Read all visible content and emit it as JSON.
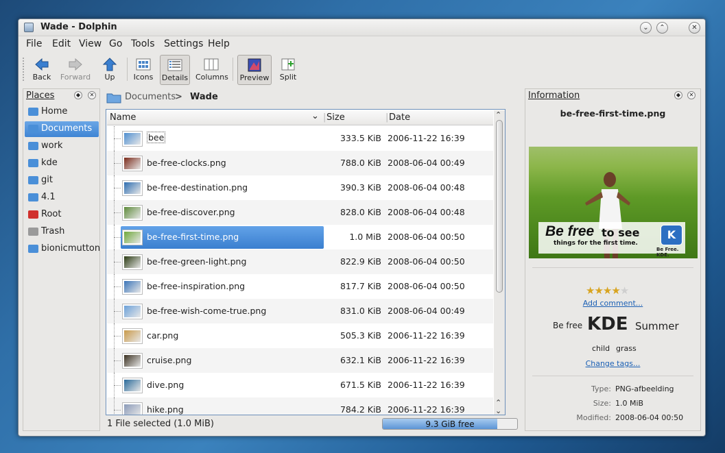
{
  "window": {
    "title": "Wade - Dolphin"
  },
  "menu": [
    "File",
    "Edit",
    "View",
    "Go",
    "Tools",
    "Settings",
    "Help"
  ],
  "toolbar": {
    "back": "Back",
    "forward": "Forward",
    "up": "Up",
    "icons": "Icons",
    "details": "Details",
    "columns": "Columns",
    "preview": "Preview",
    "split": "Split"
  },
  "places": {
    "title": "Places",
    "items": [
      {
        "label": "Home",
        "color": "#4a8fd8"
      },
      {
        "label": "Documents",
        "color": "#4a8fd8"
      },
      {
        "label": "work",
        "color": "#4a8fd8"
      },
      {
        "label": "kde",
        "color": "#4a8fd8"
      },
      {
        "label": "git",
        "color": "#4a8fd8"
      },
      {
        "label": "4.1",
        "color": "#4a8fd8"
      },
      {
        "label": "Root",
        "color": "#d0312d"
      },
      {
        "label": "Trash",
        "color": "#9a9a9a"
      },
      {
        "label": "bionicmutton",
        "color": "#4a8fd8"
      }
    ]
  },
  "breadcrumb": {
    "parent": "Documents",
    "separator": ">",
    "current": "Wade"
  },
  "columns": {
    "name": "Name",
    "size": "Size",
    "date": "Date"
  },
  "files": [
    {
      "name": "bee",
      "size": "333.5 KiB",
      "date": "2006-11-22 16:39",
      "thumb": "#4f8fd0"
    },
    {
      "name": "be-free-clocks.png",
      "size": "788.0 KiB",
      "date": "2008-06-04 00:49",
      "thumb": "#7a2a1a"
    },
    {
      "name": "be-free-destination.png",
      "size": "390.3 KiB",
      "date": "2008-06-04 00:48",
      "thumb": "#2d6db0"
    },
    {
      "name": "be-free-discover.png",
      "size": "828.0 KiB",
      "date": "2008-06-04 00:48",
      "thumb": "#5d8a3a"
    },
    {
      "name": "be-free-first-time.png",
      "size": "1.0 MiB",
      "date": "2008-06-04 00:50",
      "thumb": "#6fa83a"
    },
    {
      "name": "be-free-green-light.png",
      "size": "822.9 KiB",
      "date": "2008-06-04 00:50",
      "thumb": "#2a3a12"
    },
    {
      "name": "be-free-inspiration.png",
      "size": "817.7 KiB",
      "date": "2008-06-04 00:50",
      "thumb": "#3a74b8"
    },
    {
      "name": "be-free-wish-come-true.png",
      "size": "831.0 KiB",
      "date": "2008-06-04 00:49",
      "thumb": "#6aa0d8"
    },
    {
      "name": "car.png",
      "size": "505.3 KiB",
      "date": "2006-11-22 16:39",
      "thumb": "#c89a4a"
    },
    {
      "name": "cruise.png",
      "size": "632.1 KiB",
      "date": "2006-11-22 16:39",
      "thumb": "#3a3020"
    },
    {
      "name": "dive.png",
      "size": "671.5 KiB",
      "date": "2006-11-22 16:39",
      "thumb": "#2a6a9a"
    },
    {
      "name": "hike.png",
      "size": "784.2 KiB",
      "date": "2006-11-22 16:39",
      "thumb": "#8a9ab8"
    }
  ],
  "status": {
    "text": "1 File selected (1.0 MiB)",
    "free": "9.3 GiB free",
    "used_fraction": 0.85
  },
  "information": {
    "title": "Information",
    "filename": "be-free-first-time.png",
    "preview": {
      "line1a": "Be free",
      "line1b": "to see",
      "line2": "things for the first time.",
      "logo": "K",
      "logo_caption": "Be Free. KDE."
    },
    "rating": 4,
    "add_comment": "Add comment...",
    "tags": [
      "Be free",
      "KDE",
      "Summer",
      "child",
      "grass"
    ],
    "change_tags": "Change tags...",
    "meta": [
      {
        "key": "Type:",
        "value": "PNG-afbeelding"
      },
      {
        "key": "Size:",
        "value": "1.0 MiB"
      },
      {
        "key": "Modified:",
        "value": "2008-06-04 00:50"
      }
    ]
  },
  "selected_index": 4
}
